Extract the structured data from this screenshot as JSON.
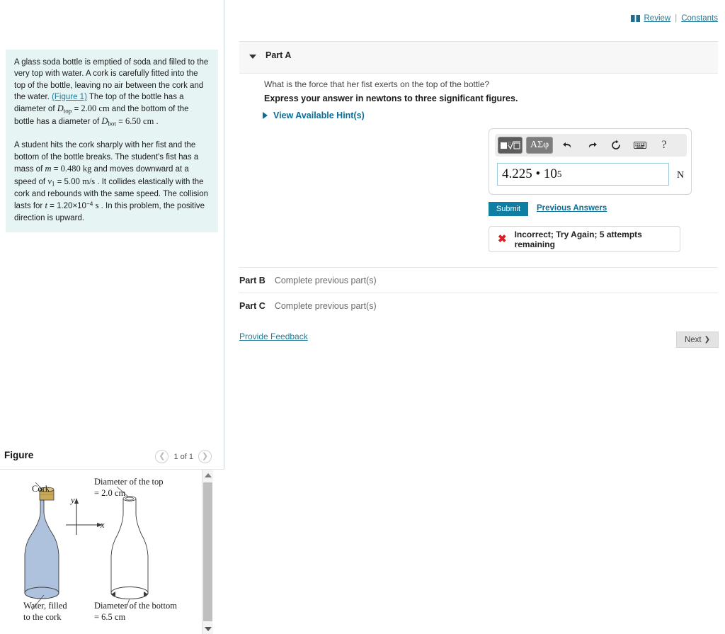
{
  "topnav": {
    "book_icon": "book-icon",
    "review_label": "Review",
    "separator": "|",
    "constants_label": "Constants"
  },
  "problem": {
    "paragraph1_part1": "A glass soda bottle is emptied of soda and filled to the very top with water. A cork is carefully fitted into the top of the bottle, leaving no air between the cork and the water. ",
    "figure_link": "(Figure 1)",
    "paragraph1_part2": " The top of the bottle has a diameter of ",
    "var_dtop": "D",
    "var_dtop_sub": "top",
    "eq1": " = ",
    "val_dtop": "2.00 cm",
    "paragraph1_part3": " and the bottom of the bottle has a diameter of ",
    "var_dbot": "D",
    "var_dbot_sub": "bot",
    "eq2": " = ",
    "val_dbot": "6.50 cm",
    "period": " .",
    "paragraph2_part1": "A student hits the cork sharply with her fist and the bottom of the bottle breaks. The student's fist has a mass of ",
    "var_m": "m",
    "eq3": " = ",
    "val_m": "0.480 kg",
    "paragraph2_part2": " and moves downward at a speed of ",
    "var_v1": "v",
    "var_v1_sub": "1",
    "eq4": " = ",
    "val_v1": "5.00",
    "unit_v1": "m/s",
    "paragraph2_part3": " . It collides elastically with the cork and rebounds with the same speed. The collision lasts for ",
    "var_t": "t",
    "eq5": " = ",
    "val_t": "1.20×10",
    "val_t_exp": "−4",
    "unit_t": "s",
    "paragraph2_part4": " . In this problem, the positive direction is upward."
  },
  "part_a": {
    "caret_icon": "caret-down-icon",
    "title": "Part A",
    "question": "What is the force that her fist exerts on the top of the bottle?",
    "instruction": "Express your answer in newtons to three significant figures.",
    "hints_caret_icon": "caret-right-icon",
    "hints_label": "View Available Hint(s)",
    "toolbar": {
      "template_label": "√",
      "greek_label": "ΑΣφ",
      "undo_icon": "undo-arrow-icon",
      "redo_icon": "redo-arrow-icon",
      "reset_icon": "reset-circle-icon",
      "keyboard_icon": "keyboard-icon",
      "help_label": "?"
    },
    "answer_value": "4.225 • 10",
    "answer_exponent": "5",
    "answer_placeholder": "",
    "answer_unit": "N",
    "submit_label": "Submit",
    "previous_answers_label": "Previous Answers",
    "feedback_icon": "error-x-icon",
    "feedback_text": "Incorrect; Try Again; 5 attempts remaining"
  },
  "part_b": {
    "name": "Part B",
    "status": "Complete previous part(s)"
  },
  "part_c": {
    "name": "Part C",
    "status": "Complete previous part(s)"
  },
  "footer": {
    "provide_feedback_label": "Provide Feedback",
    "next_label": "Next",
    "next_chevron": "❯"
  },
  "figure": {
    "title": "Figure",
    "prev_icon": "chevron-left-icon",
    "next_icon": "chevron-right-icon",
    "counter": "1 of 1",
    "scroll_up_icon": "scroll-up-arrow-icon",
    "scroll_down_icon": "scroll-down-arrow-icon",
    "labels": {
      "cork": "Cork",
      "water": "Water, filled",
      "water_line2": "to the cork",
      "top_diameter": "Diameter of the top",
      "top_diameter_value": "= 2.0 cm",
      "bottom_diameter": "Diameter of  the bottom",
      "bottom_diameter_value": "= 6.5 cm",
      "axis_y": "y",
      "axis_x": "x"
    },
    "colors": {
      "water": "#aec2dd",
      "cork": "#c8a95a",
      "outline": "#3a3a3a"
    }
  },
  "colors": {
    "accent_teal": "#0e7fa3",
    "link_blue": "#1f7a99",
    "hint_blue": "#0b6e96",
    "problem_bg": "#e6f4f4",
    "error_red": "#e01b24",
    "panel_header_bg": "#f7f7f7"
  }
}
